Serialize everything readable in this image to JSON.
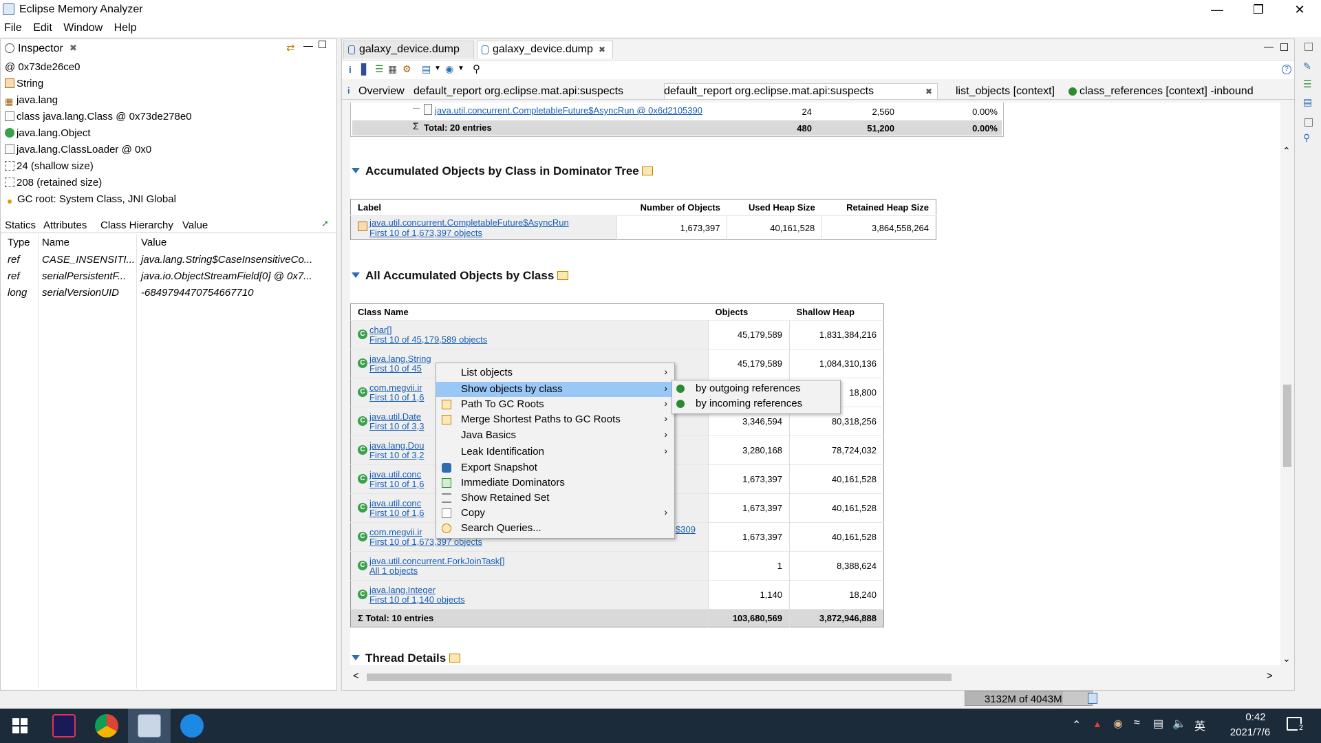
{
  "window": {
    "title": "Eclipse Memory Analyzer"
  },
  "menu": [
    "File",
    "Edit",
    "Window",
    "Help"
  ],
  "inspector": {
    "tab_label": "Inspector",
    "items": [
      {
        "icon": "at-icon",
        "text": "0x73de26ce0"
      },
      {
        "icon": "class-icon",
        "text": "String"
      },
      {
        "icon": "package-icon",
        "text": "java.lang"
      },
      {
        "icon": "class-doc-icon",
        "text": "class java.lang.Class @ 0x73de278e0"
      },
      {
        "icon": "superclass-icon",
        "text": "java.lang.Object"
      },
      {
        "icon": "classloader-icon",
        "text": "java.lang.ClassLoader @ 0x0"
      },
      {
        "icon": "size-icon",
        "text": "24 (shallow size)"
      },
      {
        "icon": "size-icon",
        "text": "208 (retained size)"
      },
      {
        "icon": "gc-root-icon",
        "text": "GC root: System Class, JNI Global"
      }
    ],
    "subtabs": [
      "Statics",
      "Attributes",
      "Class Hierarchy",
      "Value"
    ],
    "columns": [
      "Type",
      "Name",
      "Value"
    ],
    "rows": [
      {
        "type": "ref",
        "name": "CASE_INSENSITI...",
        "value": "java.lang.String$CaseInsensitiveCo..."
      },
      {
        "type": "ref",
        "name": "serialPersistentF...",
        "value": "java.io.ObjectStreamField[0] @ 0x7..."
      },
      {
        "type": "long",
        "name": "serialVersionUID",
        "value": "-6849794470754667710"
      }
    ]
  },
  "editor": {
    "tabs": [
      "galaxy_device.dump",
      "galaxy_device.dump"
    ],
    "subtabs": [
      "Overview",
      "default_report  org.eclipse.mat.api:suspects",
      "default_report  org.eclipse.mat.api:suspects",
      "list_objects  [context]",
      "class_references  [context] -inbound"
    ],
    "top_table": {
      "row": {
        "label": "java.util.concurrent.CompletableFuture$AsyncRun @ 0x6d2105390",
        "c1": "24",
        "c2": "2,560",
        "c3": "0.00%"
      },
      "total": {
        "label": "Total: 20 entries",
        "c1": "480",
        "c2": "51,200",
        "c3": "0.00%"
      }
    },
    "section1": {
      "title": "Accumulated Objects by Class in Dominator Tree",
      "columns": [
        "Label",
        "Number of Objects",
        "Used Heap Size",
        "Retained Heap Size"
      ],
      "row": {
        "label": "java.util.concurrent.CompletableFuture$AsyncRun",
        "sub": "First 10 of 1,673,397 objects",
        "c1": "1,673,397",
        "c2": "40,161,528",
        "c3": "3,864,558,264"
      }
    },
    "section2": {
      "title": "All Accumulated Objects by Class",
      "columns": [
        "Class Name",
        "Objects",
        "Shallow Heap"
      ],
      "rows": [
        {
          "name": "char[]",
          "sub": "First 10 of 45,179,589 objects",
          "objects": "45,179,589",
          "heap": "1,831,384,216"
        },
        {
          "name": "java.lang.String",
          "sub": "First 10 of 45",
          "objects": "45,179,589",
          "heap": "1,084,310,136"
        },
        {
          "name": "com.megvii.ir",
          "sub": "First 10 of 1,6",
          "objects": "",
          "heap": "18,800"
        },
        {
          "name": "java.util.Date",
          "sub": "First 10 of 3,3",
          "objects": "3,346,594",
          "heap": "80,318,256"
        },
        {
          "name": "java.lang.Dou",
          "sub": "First 10 of 3,2",
          "objects": "3,280,168",
          "heap": "78,724,032"
        },
        {
          "name": "java.util.conc",
          "sub": "First 10 of 1,6",
          "objects": "1,673,397",
          "heap": "40,161,528"
        },
        {
          "name": "java.util.conc",
          "sub": "First 10 of 1,6",
          "objects": "1,673,397",
          "heap": "40,161,528"
        },
        {
          "name": "com.megvii.ir",
          "suffix": "$309",
          "sub": "First 10 of 1,673,397 objects",
          "objects": "1,673,397",
          "heap": "40,161,528"
        },
        {
          "name": "java.util.concurrent.ForkJoinTask[]",
          "sub": "All 1 objects",
          "objects": "1",
          "heap": "8,388,624"
        },
        {
          "name": "java.lang.Integer",
          "sub": "First 10 of 1,140 objects",
          "objects": "1,140",
          "heap": "18,240"
        }
      ],
      "total": {
        "label": "Total: 10 entries",
        "objects": "103,680,569",
        "heap": "3,872,946,888"
      }
    },
    "section3": {
      "title": "Thread Details"
    }
  },
  "context_menu": {
    "items": [
      {
        "label": "List objects",
        "submenu": true,
        "icon": ""
      },
      {
        "label": "Show objects by class",
        "submenu": true,
        "icon": "",
        "highlighted": true
      },
      {
        "label": "Path To GC Roots",
        "submenu": true,
        "icon": "path-icon"
      },
      {
        "label": "Merge Shortest Paths to GC Roots",
        "submenu": true,
        "icon": "merge-icon"
      },
      {
        "label": "Java Basics",
        "submenu": true,
        "icon": ""
      },
      {
        "label": "Leak Identification",
        "submenu": true,
        "icon": ""
      },
      {
        "label": "Export Snapshot",
        "submenu": false,
        "icon": "export-icon"
      },
      {
        "label": "Immediate Dominators",
        "submenu": false,
        "icon": "dominator-icon"
      },
      {
        "label": "Show Retained Set",
        "submenu": false,
        "icon": "retained-icon"
      },
      {
        "label": "Copy",
        "submenu": true,
        "icon": "copy-icon"
      },
      {
        "label": "Search Queries...",
        "submenu": false,
        "icon": "search-queries-icon"
      }
    ],
    "submenu": [
      "by outgoing references",
      "by incoming references"
    ]
  },
  "status": {
    "heap": "3132M of 4043M"
  },
  "taskbar": {
    "time": "0:42",
    "date": "2021/7/6",
    "ime": "英",
    "notifications": "2"
  },
  "colors": {
    "highlight": "#99c8f7",
    "link": "#1a5fb4",
    "class_icon": "#3aa04a"
  }
}
